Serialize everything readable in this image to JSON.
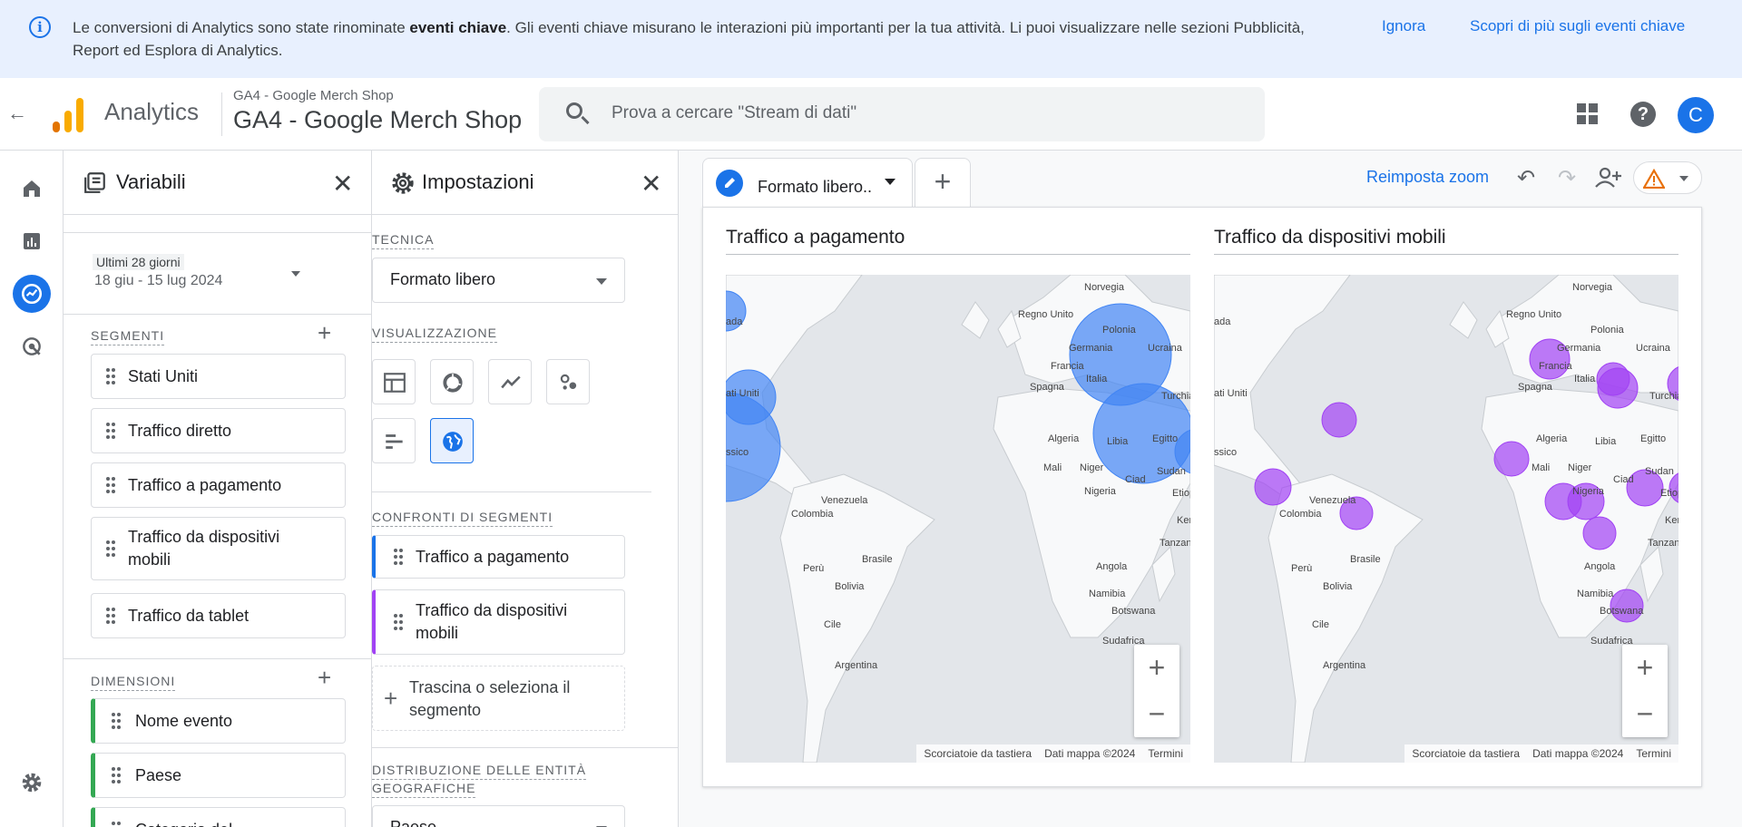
{
  "banner": {
    "text_before": "Le conversioni di Analytics sono state rinominate ",
    "text_bold": "eventi chiave",
    "text_after": ". Gli eventi chiave misurano le interazioni più importanti per la tua attività. Li puoi visualizzare nelle sezioni Pubblicità, Report ed Esplora di Analytics.",
    "dismiss": "Ignora",
    "learn_more": "Scopri di più sugli eventi chiave",
    "icon": "info-icon"
  },
  "header": {
    "app_name": "Analytics",
    "property_small": "GA4 - Google Merch Shop",
    "property_big": "GA4 - Google Merch Shop",
    "search_placeholder": "Prova a cercare \"Stream di dati\"",
    "avatar_letter": "C"
  },
  "variables": {
    "title": "Variabili",
    "date_label": "Ultimi 28 giorni",
    "date_range": "18 giu - 15 lug 2024",
    "segments_label": "SEGMENTI",
    "segments": [
      "Stati Uniti",
      "Traffico diretto",
      "Traffico a pagamento",
      "Traffico da dispositivi mobili",
      "Traffico da tablet"
    ],
    "dimensions_label": "DIMENSIONI",
    "dimensions": [
      "Nome evento",
      "Paese",
      "Categoria del"
    ]
  },
  "settings": {
    "title": "Impostazioni",
    "technique_label": "TECNICA",
    "technique_value": "Formato libero",
    "visualization_label": "VISUALIZZAZIONE",
    "compare_label": "CONFRONTI DI SEGMENTI",
    "compare_items": [
      "Traffico a pagamento",
      "Traffico da dispositivi mobili"
    ],
    "drop_hint": "Trascina o seleziona il segmento",
    "geo_label_1": "DISTRIBUZIONE DELLE ENTITÀ",
    "geo_label_2": "GEOGRAFICHE",
    "geo_value": "Paese"
  },
  "canvas": {
    "tab_label": "Formato libero..",
    "reset_zoom": "Reimposta zoom",
    "maps": [
      {
        "title": "Traffico a pagamento",
        "color": "#4285f4"
      },
      {
        "title": "Traffico da dispositivi mobili",
        "color": "#a142f4"
      }
    ],
    "attrib": [
      "Scorciatoie da tastiera",
      "Dati mappa ©2024",
      "Termini"
    ]
  },
  "map_labels": [
    "Norvegia",
    "Regno Unito",
    "Polonia",
    "Germania",
    "Ucraina",
    "Francia",
    "Italia",
    "Spagna",
    "Turchia",
    "Algeria",
    "Libia",
    "Egitto",
    "Mali",
    "Niger",
    "Ciad",
    "Sudan",
    "Nigeria",
    "Etiop",
    "Kenya",
    "Tanzan",
    "Angola",
    "Namibia",
    "Botswana",
    "Sudafrica",
    "Venezuela",
    "Colombia",
    "Perù",
    "Brasile",
    "Bolivia",
    "Cile",
    "Argentina",
    "ati Uniti",
    "ada",
    "ssico"
  ],
  "colors": {
    "accent": "#1a73e8",
    "paid": "#4285f4",
    "mobile": "#a142f4",
    "dimension": "#34a853"
  }
}
